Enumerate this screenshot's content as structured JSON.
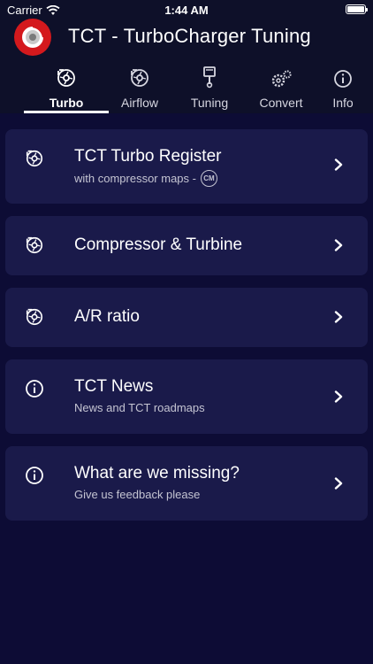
{
  "status_bar": {
    "carrier": "Carrier",
    "time": "1:44 AM"
  },
  "app": {
    "title": "TCT - TurboCharger Tuning",
    "logo_icon": "turbo-logo-icon"
  },
  "tabs": [
    {
      "label": "Turbo",
      "icon": "turbo-icon",
      "active": true
    },
    {
      "label": "Airflow",
      "icon": "airflow-icon",
      "active": false
    },
    {
      "label": "Tuning",
      "icon": "piston-icon",
      "active": false
    },
    {
      "label": "Convert",
      "icon": "gears-icon",
      "active": false
    },
    {
      "label": "Info",
      "icon": "info-icon",
      "active": false
    }
  ],
  "menu": [
    {
      "title": "TCT Turbo Register",
      "subtitle": "with compressor maps -",
      "badge": "CM",
      "icon": "turbo-icon"
    },
    {
      "title": "Compressor & Turbine",
      "subtitle": "",
      "icon": "turbo-icon"
    },
    {
      "title": "A/R ratio",
      "subtitle": "",
      "icon": "turbo-icon"
    },
    {
      "title": "TCT News",
      "subtitle": "News and TCT roadmaps",
      "icon": "info-icon"
    },
    {
      "title": "What are we missing?",
      "subtitle": "Give us feedback please",
      "icon": "info-icon"
    }
  ],
  "colors": {
    "background": "#0d0c35",
    "header": "#0e1029",
    "card": "#1a1a4a",
    "logo": "#d4191d"
  }
}
